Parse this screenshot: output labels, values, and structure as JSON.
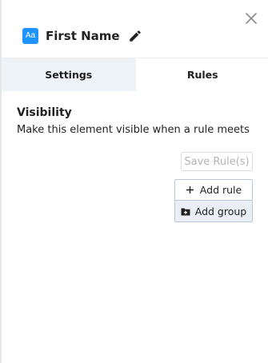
{
  "header": {
    "field_icon_text": "Aa",
    "title": "First Name",
    "icons": {
      "field": "text-field-icon",
      "edit": "pencil-icon",
      "close": "close-icon"
    }
  },
  "tabs": [
    {
      "label": "Settings",
      "active": false
    },
    {
      "label": "Rules",
      "active": true
    }
  ],
  "visibility": {
    "title": "Visibility",
    "description": "Make this element visible when a rule meets"
  },
  "actions": {
    "save_label": "Save Rule(s)",
    "add_rule_label": "Add rule",
    "add_group_label": "Add group"
  },
  "colors": {
    "accent": "#1f93ff",
    "inactive_tab": "#eef3f8",
    "add_group_bg": "#e9eff5",
    "disabled_text": "#b3b3b3"
  }
}
